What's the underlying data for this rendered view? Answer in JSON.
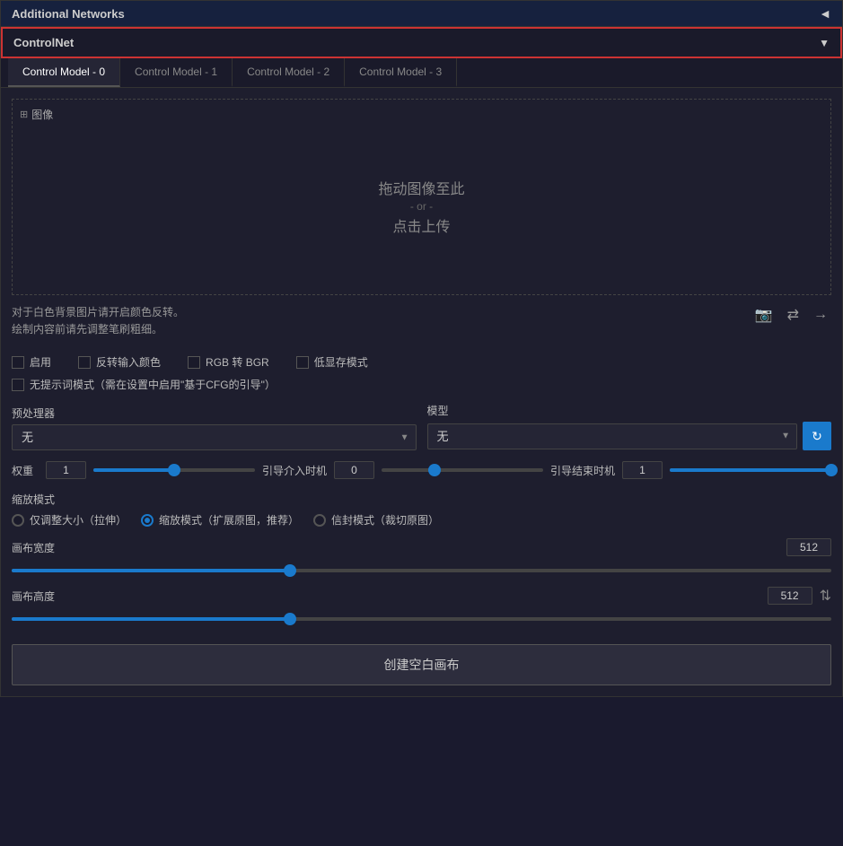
{
  "header": {
    "title": "Additional Networks",
    "arrow": "◄"
  },
  "controlnet": {
    "label": "ControlNet",
    "dropdown_arrow": "▼"
  },
  "tabs": [
    {
      "label": "Control Model - 0",
      "active": true
    },
    {
      "label": "Control Model - 1",
      "active": false
    },
    {
      "label": "Control Model - 2",
      "active": false
    },
    {
      "label": "Control Model - 3",
      "active": false
    }
  ],
  "image_section": {
    "label": "图像",
    "upload_main": "拖动图像至此",
    "upload_or": "- or -",
    "upload_click": "点击上传"
  },
  "hint_text": "对于白色背景图片请开启颜色反转。\n绘制内容前请先调整笔刷粗细。",
  "checkboxes": {
    "enable": "启用",
    "invert_input": "反转输入颜色",
    "rgb_bgr": "RGB 转 BGR",
    "low_vram": "低显存模式",
    "no_prompt": "无提示词模式（需在设置中启用\"基于CFG的引导\"）"
  },
  "preprocessor": {
    "label": "预处理器",
    "value": "无"
  },
  "model": {
    "label": "模型",
    "value": "无"
  },
  "sliders": {
    "weight_label": "权重",
    "weight_value": "1",
    "weight_percent": 50,
    "guidance_start_label": "引导介入时机",
    "guidance_start_value": "0",
    "guidance_start_percent": 33,
    "guidance_end_label": "引导结束时机",
    "guidance_end_value": "1",
    "guidance_end_percent": 100
  },
  "resize_mode": {
    "label": "缩放模式",
    "options": [
      {
        "label": "仅调整大小（拉伸）",
        "checked": false
      },
      {
        "label": "缩放模式（扩展原图，推荐）",
        "checked": true
      },
      {
        "label": "信封模式（裁切原图）",
        "checked": false
      }
    ]
  },
  "canvas": {
    "width_label": "画布宽度",
    "width_value": "512",
    "width_percent": 34,
    "height_label": "画布高度",
    "height_value": "512",
    "height_percent": 34
  },
  "create_btn": "创建空白画布"
}
